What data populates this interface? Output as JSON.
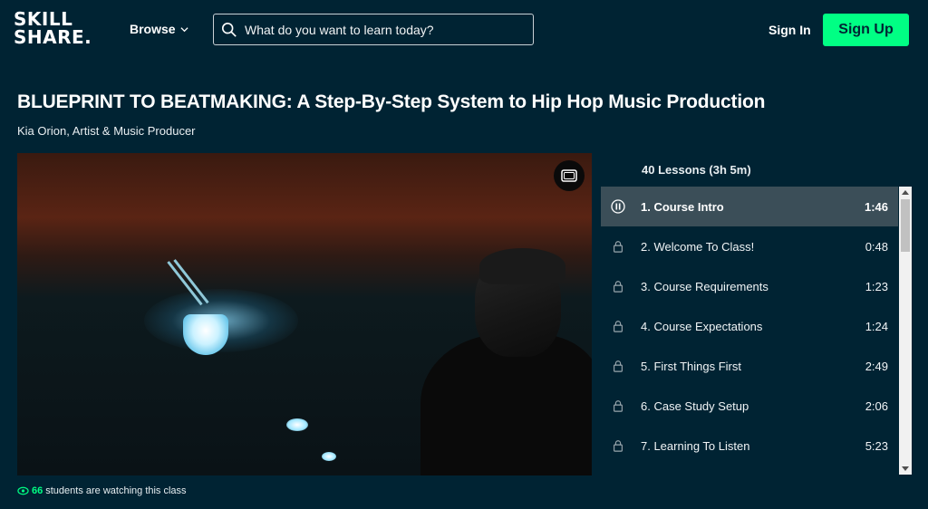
{
  "header": {
    "logo_line1": "SKILL",
    "logo_line2": "SHARE.",
    "browse_label": "Browse",
    "search_placeholder": "What do you want to learn today?",
    "signin_label": "Sign In",
    "signup_label": "Sign Up"
  },
  "course": {
    "title": "BLUEPRINT TO BEATMAKING: A Step-By-Step System to Hip Hop Music Production",
    "author": "Kia Orion, Artist & Music Producer",
    "watching_count": "66",
    "watching_text": "students are watching this class"
  },
  "lessons": {
    "header": "40 Lessons (3h 5m)",
    "items": [
      {
        "label": "1. Course Intro",
        "duration": "1:46",
        "state": "playing"
      },
      {
        "label": "2. Welcome To Class!",
        "duration": "0:48",
        "state": "locked"
      },
      {
        "label": "3. Course Requirements",
        "duration": "1:23",
        "state": "locked"
      },
      {
        "label": "4. Course Expectations",
        "duration": "1:24",
        "state": "locked"
      },
      {
        "label": "5. First Things First",
        "duration": "2:49",
        "state": "locked"
      },
      {
        "label": "6. Case Study Setup",
        "duration": "2:06",
        "state": "locked"
      },
      {
        "label": "7. Learning To Listen",
        "duration": "5:23",
        "state": "locked"
      }
    ]
  },
  "colors": {
    "background": "#002333",
    "accent": "#00ff84",
    "active_row": "#3b4e58"
  },
  "icons": [
    "search-icon",
    "chevron-down-icon",
    "pip-icon",
    "pause-icon",
    "lock-icon",
    "eye-icon"
  ]
}
